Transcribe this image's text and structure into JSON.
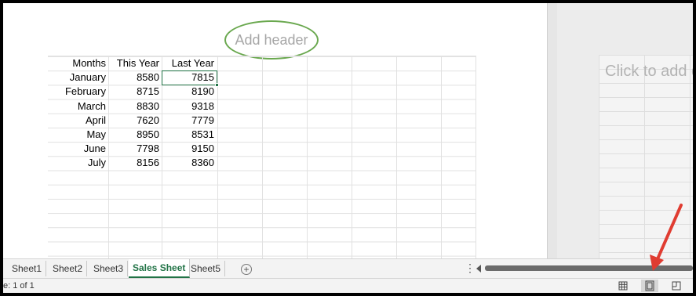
{
  "header_placeholder": "Add header",
  "right_page_placeholder": "Click to add da",
  "table": {
    "headers": [
      "Months",
      "This Year",
      "Last Year"
    ],
    "rows": [
      [
        "January",
        "8580",
        "7815"
      ],
      [
        "February",
        "8715",
        "8190"
      ],
      [
        "March",
        "8830",
        "9318"
      ],
      [
        "April",
        "7620",
        "7779"
      ],
      [
        "May",
        "8950",
        "8531"
      ],
      [
        "June",
        "7798",
        "9150"
      ],
      [
        "July",
        "8156",
        "8360"
      ]
    ]
  },
  "sheet_tabs": [
    "Sheet1",
    "Sheet2",
    "Sheet3",
    "Sales Sheet",
    "Sheet5"
  ],
  "active_tab": "Sales Sheet",
  "status": {
    "page_info": "e: 1 of 1"
  },
  "view_buttons": [
    "normal-view",
    "page-layout-view",
    "page-break-preview"
  ],
  "selected_view": "page-layout-view",
  "colors": {
    "accent": "#217346",
    "annotation": "#6aa84f",
    "arrow": "#e03c31"
  }
}
